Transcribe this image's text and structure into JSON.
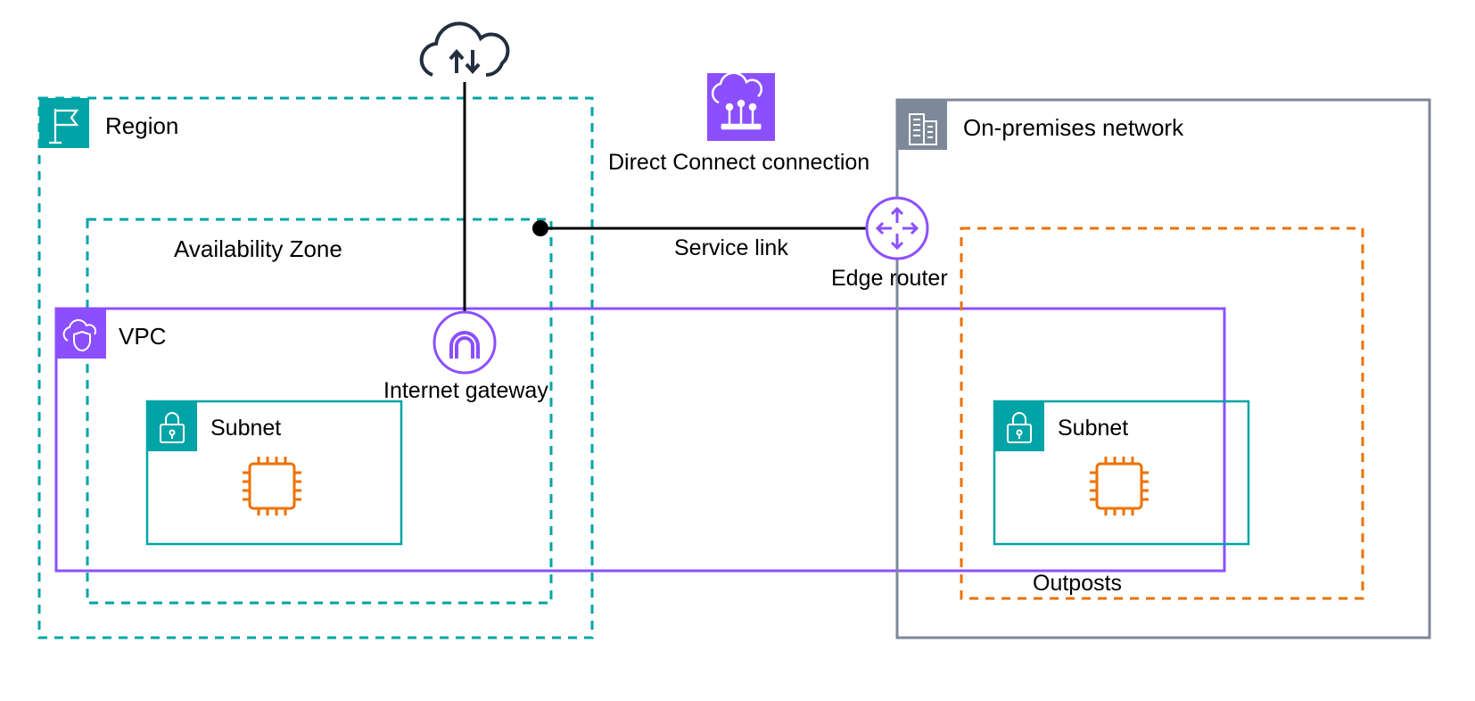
{
  "labels": {
    "region": "Region",
    "az": "Availability Zone",
    "vpc": "VPC",
    "subnet_region": "Subnet",
    "subnet_outpost": "Subnet",
    "igw": "Internet gateway",
    "dx": "Direct Connect connection",
    "service_link": "Service link",
    "edge_router": "Edge router",
    "onprem": "On-premises network",
    "outposts": "Outposts"
  },
  "colors": {
    "teal": "#00A4A6",
    "purple": "#8C4FFF",
    "purple_box": "#7B2BFF",
    "orange": "#ED7100",
    "gray": "#7D8998",
    "dark": "#232F3E",
    "white": "#FFFFFF",
    "black": "#000000"
  }
}
